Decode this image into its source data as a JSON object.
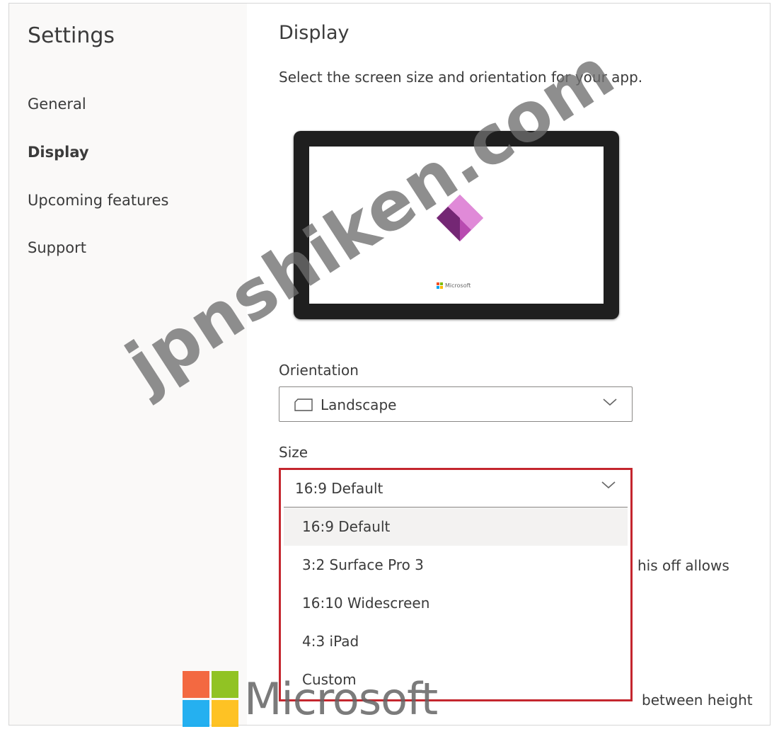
{
  "sidebar": {
    "title": "Settings",
    "items": [
      {
        "label": "General",
        "active": false
      },
      {
        "label": "Display",
        "active": true
      },
      {
        "label": "Upcoming features",
        "active": false
      },
      {
        "label": "Support",
        "active": false
      }
    ]
  },
  "main": {
    "title": "Display",
    "description": "Select the screen size and orientation for your app.",
    "preview": {
      "brand_text": "Microsoft",
      "logo_colors": [
        "#742774",
        "#b84bb0",
        "#e08ad8"
      ]
    },
    "orientation": {
      "label": "Orientation",
      "value": "Landscape"
    },
    "size": {
      "label": "Size",
      "value": "16:9 Default",
      "options": [
        "16:9 Default",
        "3:2 Surface Pro 3",
        "16:10 Widescreen",
        "4:3 iPad",
        "Custom"
      ],
      "selected_index": 0,
      "highlight_color": "#c4262e"
    },
    "partial_text": {
      "behind_dropdown": "his off allows",
      "footer_fragment": "between height"
    }
  },
  "overlays": {
    "watermark": "jpnshiken.com",
    "brand_logo_text": "Microsoft",
    "brand_colors": [
      "#f25022",
      "#7fba00",
      "#00a4ef",
      "#ffb900"
    ]
  }
}
